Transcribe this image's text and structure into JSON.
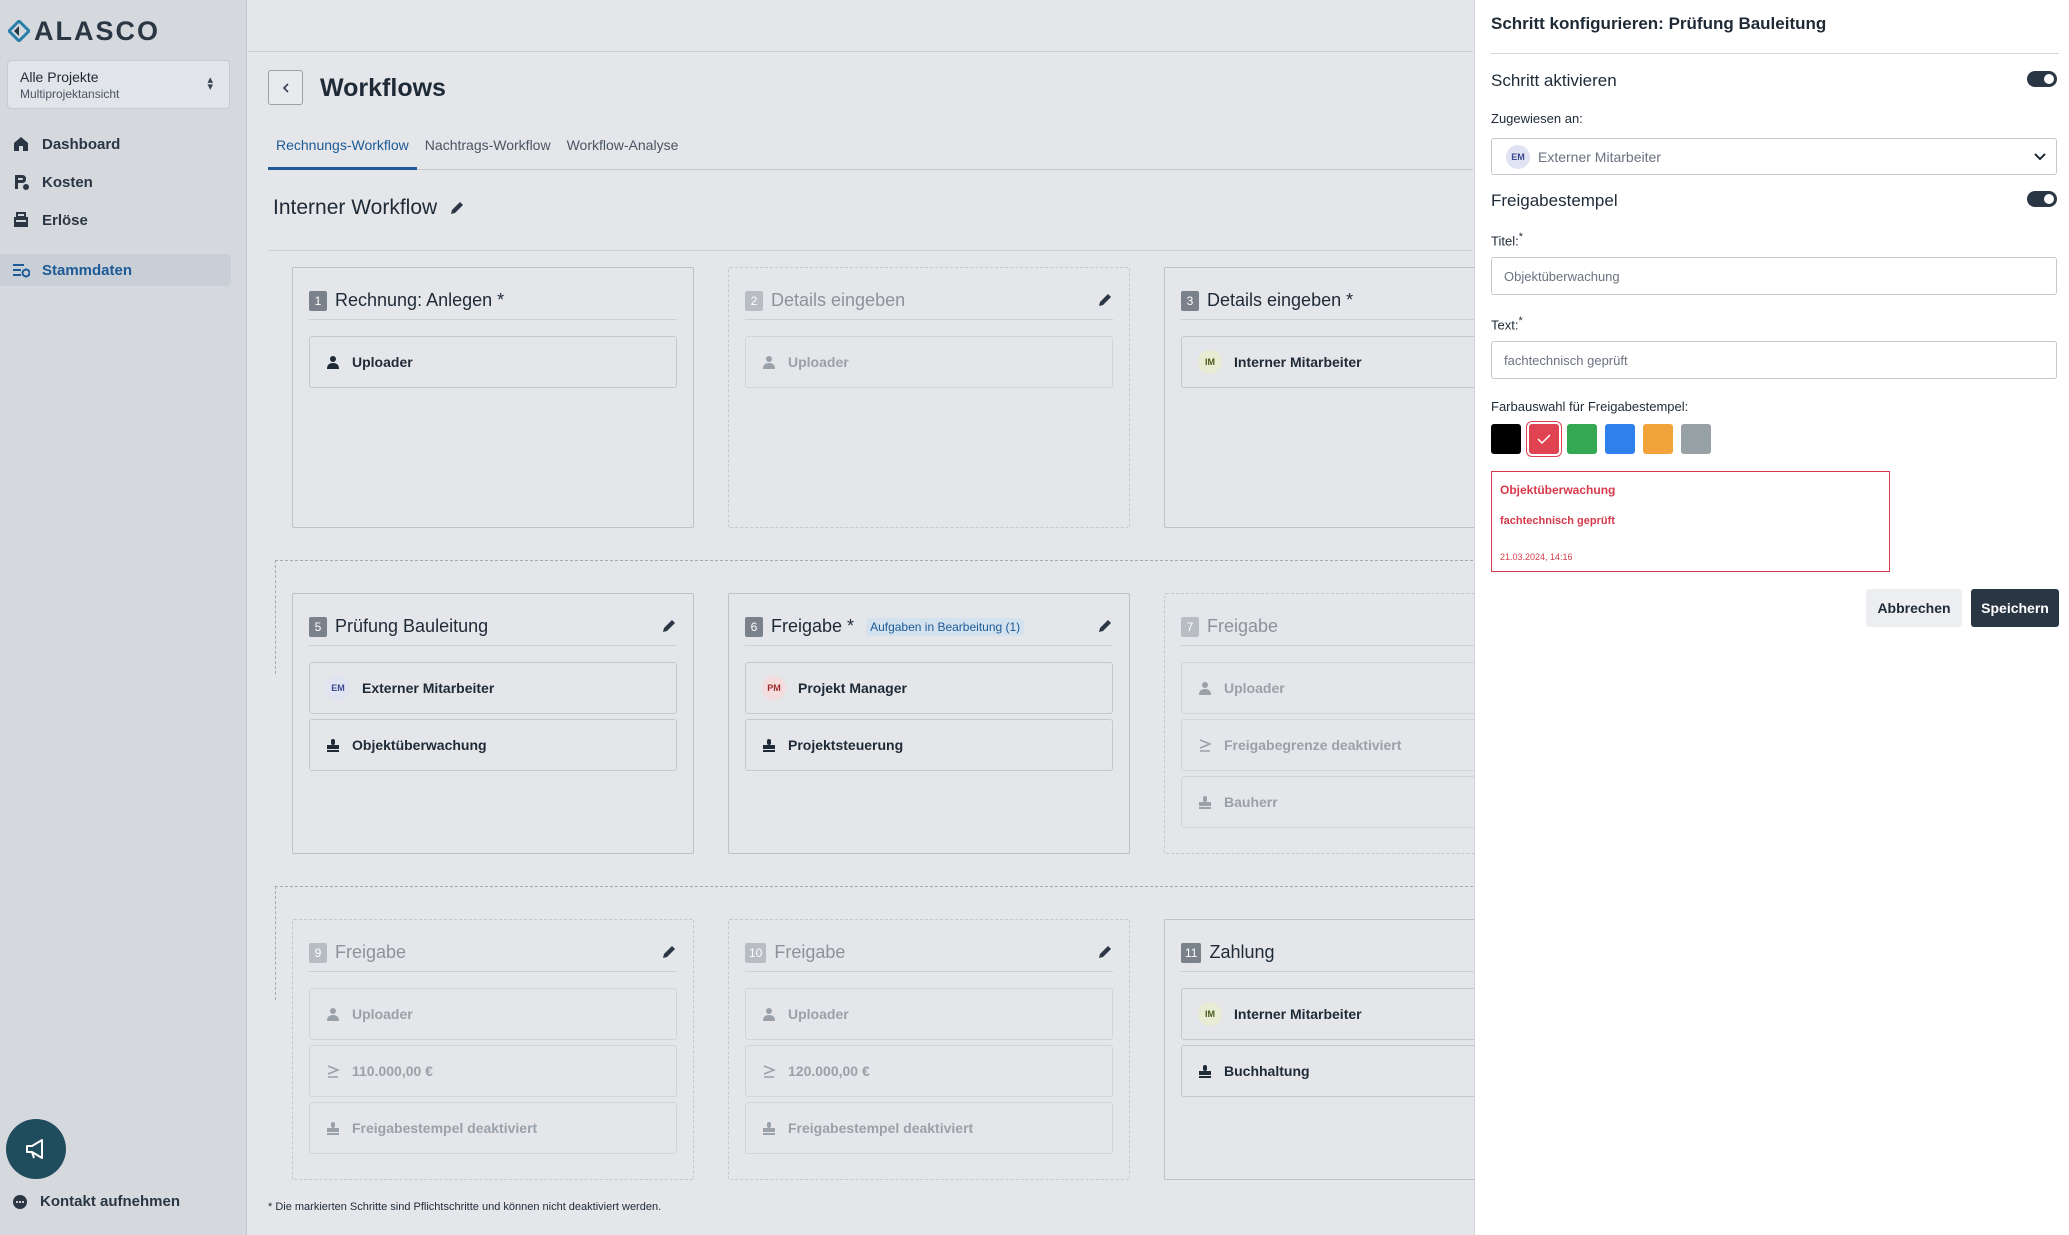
{
  "app": {
    "logo_text": "ALASCO"
  },
  "sidebar": {
    "project_selector": {
      "title": "Alle Projekte",
      "subtitle": "Multiprojektansicht"
    },
    "items": [
      {
        "label": "Dashboard",
        "icon": "home-icon"
      },
      {
        "label": "Kosten",
        "icon": "cost-icon"
      },
      {
        "label": "Erlöse",
        "icon": "revenue-icon"
      },
      {
        "label": "Stammdaten",
        "icon": "settings-icon",
        "active": true
      }
    ],
    "contact_label": "Kontakt aufnehmen"
  },
  "main": {
    "page_title": "Workflows",
    "tabs": [
      {
        "label": "Rechnungs-Workflow",
        "active": true
      },
      {
        "label": "Nachtrags-Workflow"
      },
      {
        "label": "Workflow-Analyse"
      }
    ],
    "workflow_title": "Interner Workflow",
    "steps": [
      {
        "number": "1",
        "title": "Rechnung: Anlegen *",
        "rows": [
          {
            "icon": "user-icon",
            "label": "Uploader"
          }
        ]
      },
      {
        "number": "2",
        "title": "Details eingeben",
        "disabled": true,
        "rows": [
          {
            "icon": "user-icon",
            "label": "Uploader"
          }
        ]
      },
      {
        "number": "3",
        "title": "Details eingeben *",
        "rows": [
          {
            "avatar": "IM",
            "label": "Interner Mitarbeiter"
          }
        ]
      },
      {
        "number": "5",
        "title": "Prüfung Bauleitung",
        "rows": [
          {
            "avatar": "EM",
            "label": "Externer Mitarbeiter"
          },
          {
            "icon": "stamp-icon",
            "label": "Objektüberwachung"
          }
        ]
      },
      {
        "number": "6",
        "title": "Freigabe *",
        "badge": "Aufgaben in Bearbeitung (1)",
        "rows": [
          {
            "avatar": "PM",
            "label": "Projekt Manager"
          },
          {
            "icon": "stamp-icon",
            "label": "Projektsteuerung"
          }
        ]
      },
      {
        "number": "7",
        "title": "Freigabe",
        "disabled": true,
        "rows": [
          {
            "icon": "user-icon",
            "label": "Uploader"
          },
          {
            "icon": "threshold-icon",
            "label": "Freigabegrenze deaktiviert"
          },
          {
            "icon": "stamp-icon",
            "label": "Bauherr"
          }
        ]
      },
      {
        "number": "9",
        "title": "Freigabe",
        "disabled": true,
        "rows": [
          {
            "icon": "user-icon",
            "label": "Uploader"
          },
          {
            "icon": "threshold-icon",
            "label": "110.000,00 €"
          },
          {
            "icon": "stamp-icon",
            "label": "Freigabestempel deaktiviert"
          }
        ]
      },
      {
        "number": "10",
        "title": "Freigabe",
        "disabled": true,
        "rows": [
          {
            "icon": "user-icon",
            "label": "Uploader"
          },
          {
            "icon": "threshold-icon",
            "label": "120.000,00 €"
          },
          {
            "icon": "stamp-icon",
            "label": "Freigabestempel deaktiviert"
          }
        ]
      },
      {
        "number": "11",
        "title": "Zahlung",
        "rows": [
          {
            "avatar": "IM",
            "label": "Interner Mitarbeiter"
          },
          {
            "icon": "stamp-icon",
            "label": "Buchhaltung"
          }
        ]
      }
    ],
    "footnote": "* Die markierten Schritte sind Pflichtschritte und können nicht deaktiviert werden."
  },
  "panel": {
    "title": "Schritt konfigurieren: Prüfung Bauleitung",
    "activate_label": "Schritt aktivieren",
    "activate_on": true,
    "assigned_label": "Zugewiesen an:",
    "assigned_avatar": "EM",
    "assigned_value": "Externer Mitarbeiter",
    "stamp_label": "Freigabestempel",
    "stamp_on": true,
    "title_field_label": "Titel:",
    "title_field_value": "Objektüberwachung",
    "text_field_label": "Text:",
    "text_field_value": "fachtechnisch geprüft",
    "required_mark": "*",
    "color_label": "Farbauswahl für Freigabestempel:",
    "colors": [
      "#000000",
      "#e04352",
      "#34a853",
      "#2f80ed",
      "#f2a33a",
      "#98a2a6"
    ],
    "selected_color": "#e04352",
    "preview": {
      "title": "Objektüberwachung",
      "text": "fachtechnisch geprüft",
      "date": "21.03.2024, 14:16"
    },
    "cancel_label": "Abbrechen",
    "save_label": "Speichern"
  }
}
